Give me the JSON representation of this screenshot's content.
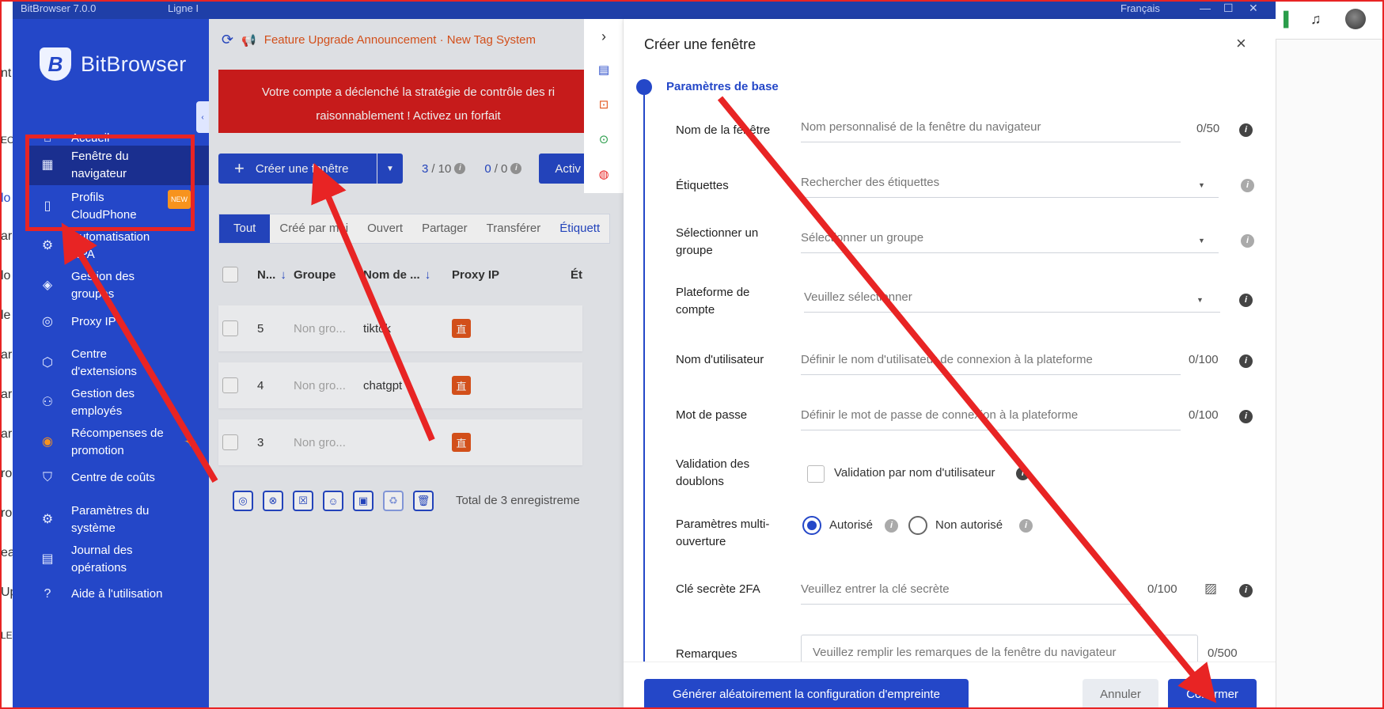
{
  "screen_edge": {
    "left_fragments": [
      "nt",
      "EC",
      "lo",
      "ar",
      "lo",
      "le",
      "ar",
      "ar",
      "ar",
      "ro",
      "ro",
      "ea",
      "Up",
      "LE"
    ],
    "colors": {
      "highlight": "#e82424"
    }
  },
  "titlebar": {
    "title": "BitBrowser 7.0.0",
    "line": "Ligne I",
    "language": "Français",
    "icons": [
      "minimize-icon",
      "maximize-icon",
      "close-icon"
    ]
  },
  "sidebar": {
    "brand": "BitBrowser",
    "collapse_icon": "‹",
    "items": [
      {
        "icon": "home-icon",
        "label": "Accueil"
      },
      {
        "icon": "grid-icon",
        "label": "Fenêtre du navigateur"
      },
      {
        "icon": "phone-icon",
        "label": "Profils CloudPhone",
        "badge": "NEW"
      },
      {
        "icon": "robot-icon",
        "label": "Automatisation RPA"
      },
      {
        "icon": "layers-icon",
        "label": "Gestion des groupes"
      },
      {
        "icon": "location-icon",
        "label": "Proxy IP"
      },
      {
        "icon": "cube-icon",
        "label": "Centre d'extensions"
      },
      {
        "icon": "users-icon",
        "label": "Gestion des employés"
      },
      {
        "icon": "gift-icon",
        "label": "Récompenses de promotion"
      },
      {
        "icon": "shield-icon",
        "label": "Centre de coûts"
      },
      {
        "icon": "gear-icon",
        "label": "Paramètres du système"
      },
      {
        "icon": "log-icon",
        "label": "Journal des opérations"
      },
      {
        "icon": "help-icon",
        "label": "Aide à l'utilisation"
      }
    ]
  },
  "main": {
    "announcement": "Feature Upgrade Announcement · New Tag System",
    "alert_line1": "Votre compte a déclenché la stratégie de contrôle des ri",
    "alert_line2": "raisonnablement ! Activez un forfait",
    "create_button": "Créer une fenêtre",
    "counter1": "3",
    "counter1_total": "/ 10",
    "counter2": "0",
    "counter2_total": "/ 0",
    "activ_button": "Activ",
    "tabs": [
      "Tout",
      "Créé par moi",
      "Ouvert",
      "Partager",
      "Transférer",
      "Étiquett"
    ],
    "columns": [
      "N...",
      "Groupe",
      "Nom de ...",
      "Proxy IP",
      "Ét"
    ],
    "rows": [
      {
        "num": "5",
        "group": "Non gro...",
        "name": "tiktok",
        "proxy": "直"
      },
      {
        "num": "4",
        "group": "Non gro...",
        "name": "chatgpt",
        "proxy": "直"
      },
      {
        "num": "3",
        "group": "Non gro...",
        "name": "",
        "proxy": "直"
      }
    ],
    "bulk_icons": [
      "chrome-icon",
      "close-circle-icon",
      "close-square-icon",
      "robot-icon",
      "window-icon",
      "trash-clock-icon",
      "trash-icon"
    ],
    "total": "Total de 3 enregistreme"
  },
  "quick_panel": {
    "expand": "›",
    "icons": [
      "window-sync-icon",
      "ip-icon",
      "toggle-icon",
      "fingerprint-icon"
    ]
  },
  "dialog": {
    "title": "Créer une fenêtre",
    "close": "×",
    "section": "Paramètres de base",
    "fields": {
      "name": {
        "label": "Nom de la fenêtre",
        "placeholder": "Nom personnalisé de la fenêtre du navigateur",
        "count": "0/50"
      },
      "tags": {
        "label": "Étiquettes",
        "placeholder": "Rechercher des étiquettes"
      },
      "group": {
        "label": "Sélectionner un groupe",
        "placeholder": "Sélectionner un groupe"
      },
      "platform": {
        "label": "Plateforme de compte",
        "placeholder": "Veuillez sélectionner"
      },
      "username": {
        "label": "Nom d'utilisateur",
        "placeholder": "Définir le nom d'utilisateur de connexion à la plateforme",
        "count": "0/100"
      },
      "password": {
        "label": "Mot de passe",
        "placeholder": "Définir le mot de passe de connexion à la plateforme",
        "count": "0/100"
      },
      "dup": {
        "label": "Validation des doublons",
        "option": "Validation par nom d'utilisateur"
      },
      "multi": {
        "label": "Paramètres multi-ouverture",
        "opt_yes": "Autorisé",
        "opt_no": "Non autorisé",
        "selected": "Autorisé"
      },
      "twofa": {
        "label": "Clé secrète 2FA",
        "placeholder": "Veuillez entrer la clé secrète",
        "count": "0/100"
      },
      "remarks": {
        "label": "Remarques",
        "placeholder": "Veuillez remplir les remarques de la fenêtre du navigateur",
        "count": "0/500"
      }
    },
    "generate_button": "Générer aléatoirement la configuration d'empreinte",
    "cancel_button": "Annuler",
    "confirm_button": "Confirmer"
  },
  "colors": {
    "primary": "#2447c8",
    "sidebar_active": "#1a2f8f",
    "alert": "#d51c1c",
    "announce": "#e2541b",
    "arrow": "#e82424"
  }
}
